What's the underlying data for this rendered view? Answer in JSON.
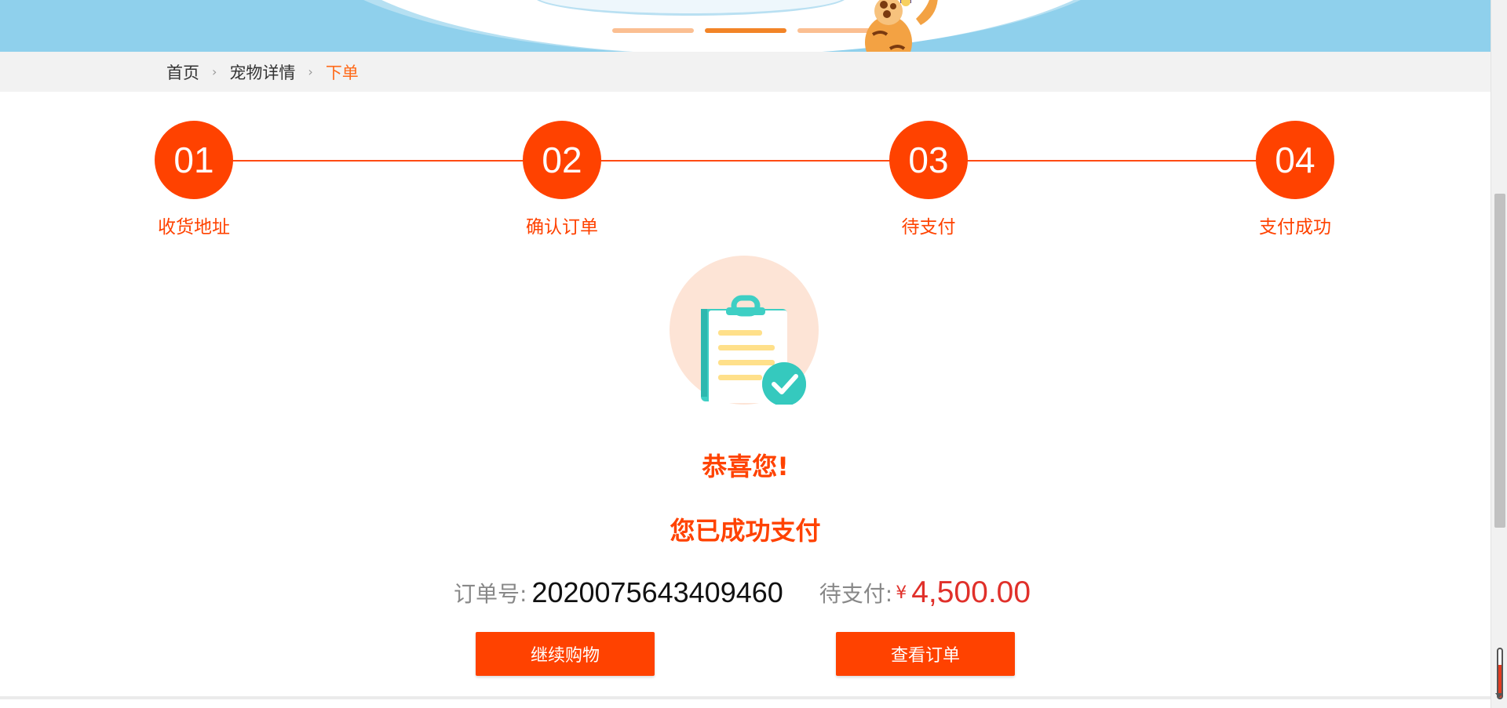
{
  "breadcrumb": {
    "items": [
      {
        "label": "首页"
      },
      {
        "label": "宠物详情"
      },
      {
        "label": "下单"
      }
    ]
  },
  "steps": [
    {
      "number": "01",
      "label": "收货地址"
    },
    {
      "number": "02",
      "label": "确认订单"
    },
    {
      "number": "03",
      "label": "待支付"
    },
    {
      "number": "04",
      "label": "支付成功"
    }
  ],
  "result": {
    "title": "恭喜您!",
    "subtitle": "您已成功支付"
  },
  "order": {
    "number_label": "订单号:",
    "number": "2020075643409460",
    "pending_label": "待支付:",
    "currency": "¥",
    "amount": "4,500.00"
  },
  "buttons": {
    "continue_label": "继续购物",
    "view_orders_label": "查看订单"
  },
  "colors": {
    "accent": "#ff4200",
    "price": "#e0302a",
    "banner": "#8fd0ec",
    "breadcrumb_bg": "#f2f2f2"
  },
  "icons": {
    "illustration": "clipboard-check-icon",
    "breadcrumb_separator": "chevron-right-icon"
  },
  "carousel": {
    "slide_count": 3,
    "active_slide": 2
  }
}
